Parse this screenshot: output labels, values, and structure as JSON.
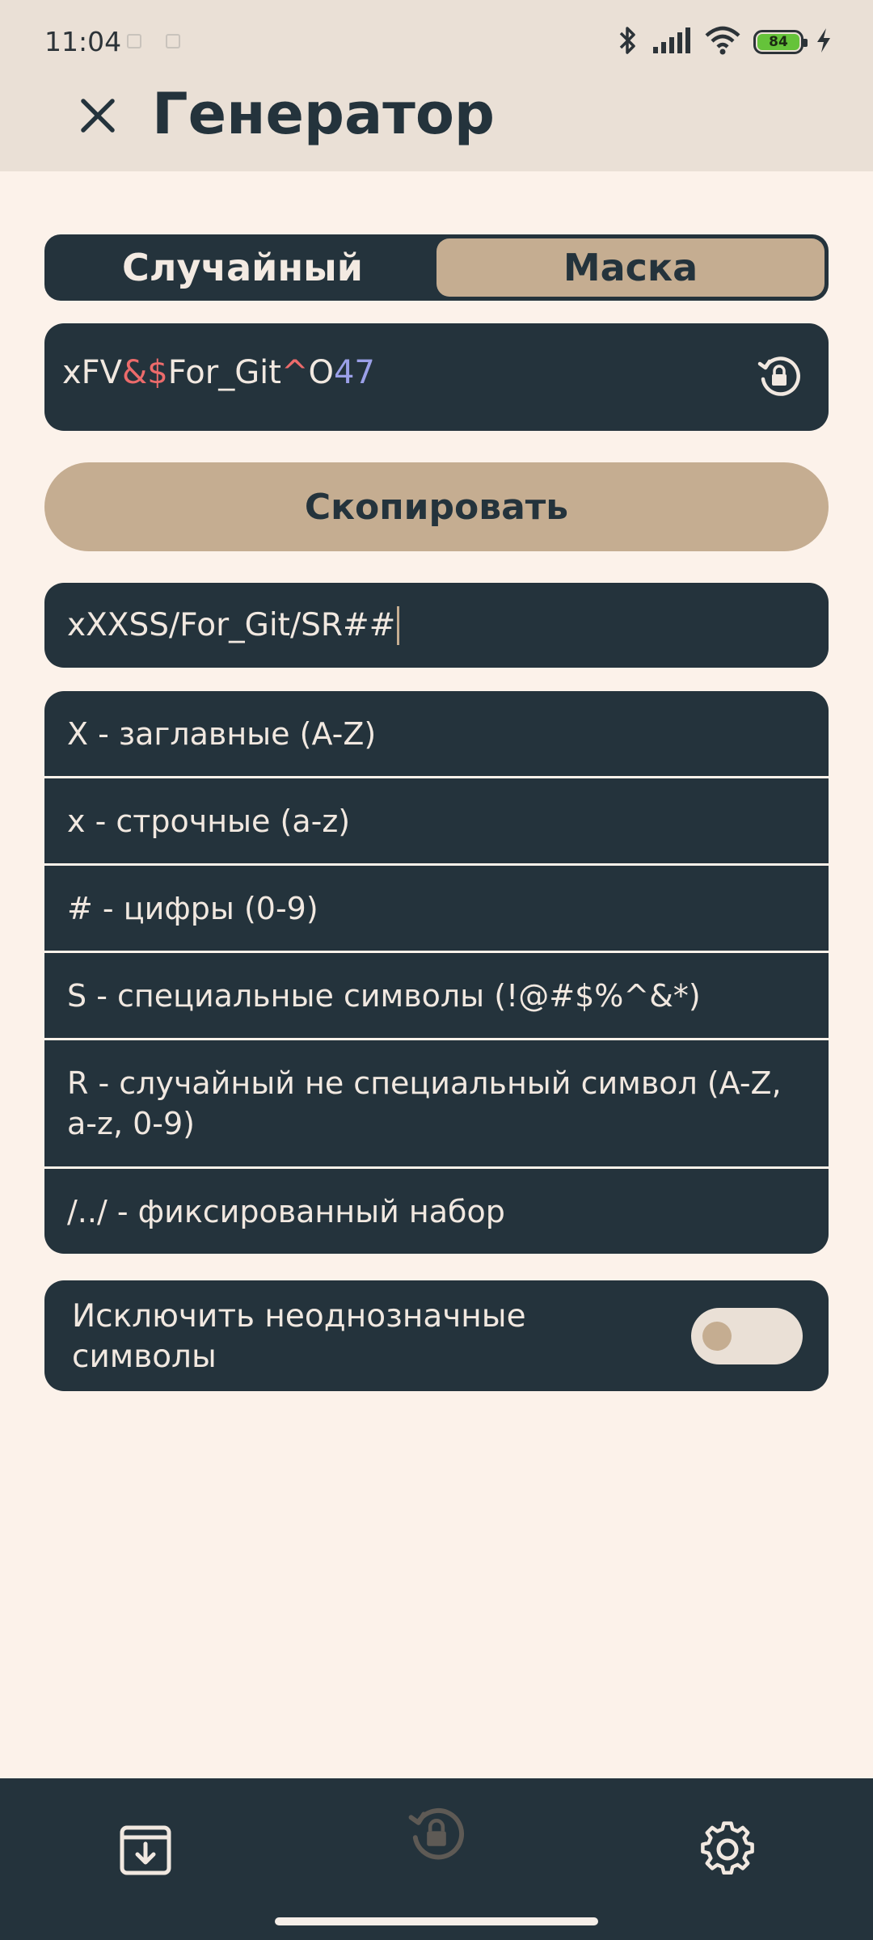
{
  "status_bar": {
    "time": "11:04",
    "battery_level": "84"
  },
  "app_bar": {
    "title": "Генератор",
    "close_icon": "close-icon"
  },
  "mode_tabs": [
    {
      "label": "Случайный",
      "selected": false
    },
    {
      "label": "Маска",
      "selected": true
    }
  ],
  "password": {
    "parts": [
      "xFV",
      "&$",
      "For_Git",
      "^",
      "O",
      "47"
    ],
    "regenerate_icon": "history-lock-icon"
  },
  "copy_button": {
    "label": "Скопировать"
  },
  "mask_input": {
    "value": "xXXSS/For_Git/SR##"
  },
  "legend": [
    "X - заглавные (A-Z)",
    "x - строчные (a-z)",
    "# - цифры (0-9)",
    "S - специальные символы (!@#$%^&*)",
    "R - случайный не специальный символ (A-Z, a-z, 0-9)",
    "/../ - фиксированный набор"
  ],
  "exclude_ambiguous": {
    "label": "Исключить неоднозначные символы",
    "enabled": false
  },
  "bottom_nav": [
    {
      "icon": "archive-download-icon"
    },
    {
      "icon": "history-lock-icon"
    },
    {
      "icon": "gear-icon"
    }
  ],
  "colors": {
    "dark": "#24333C",
    "accent": "#C5AD91",
    "background": "#FCF2EA",
    "special_char": "#EC6B6B",
    "digit_char": "#9BA0E8"
  }
}
